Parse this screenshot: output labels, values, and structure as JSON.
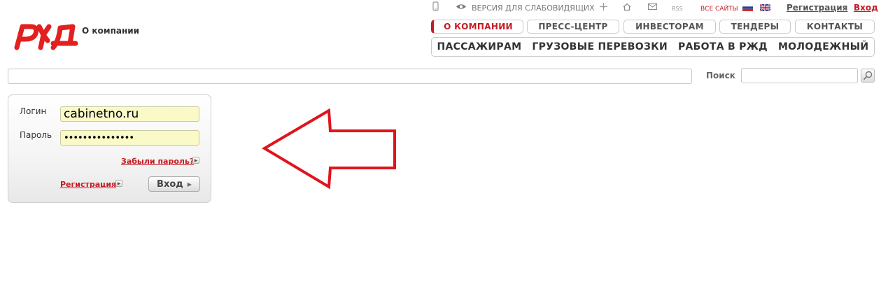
{
  "header": {
    "about_label": "О компании",
    "utility": {
      "vision_label": "ВЕРСИЯ ДЛЯ СЛАБОВИДЯЩИХ",
      "rss_label": "RSS",
      "all_sites_label": "ВСЕ САЙТЫ",
      "register_label": "Регистрация",
      "login_label": "Вход"
    },
    "nav_primary": [
      "О КОМПАНИИ",
      "ПРЕСС-ЦЕНТР",
      "ИНВЕСТОРАМ",
      "ТЕНДЕРЫ",
      "КОНТАКТЫ"
    ],
    "nav_secondary": [
      "ПАССАЖИРАМ",
      "ГРУЗОВЫЕ ПЕРЕВОЗКИ",
      "РАБОТА В РЖД",
      "МОЛОДЕЖНЫЙ"
    ]
  },
  "search": {
    "label": "Поиск",
    "value": ""
  },
  "login_form": {
    "login_label": "Логин",
    "login_value": "cabinetno.ru",
    "password_label": "Пароль",
    "password_value": "•••••••••••••••",
    "forgot_label": "Забыли пароль?",
    "register_label": "Регистрация",
    "submit_label": "Вход"
  },
  "colors": {
    "brand_red": "#c51b23",
    "field_bg": "#fafac8"
  },
  "icons": [
    "rzd-logo",
    "phone-icon",
    "eye-icon",
    "sitemap-icon",
    "home-icon",
    "mail-icon",
    "flag-ru-icon",
    "flag-uk-icon",
    "magnifier-icon",
    "arrow-left-annotation"
  ]
}
